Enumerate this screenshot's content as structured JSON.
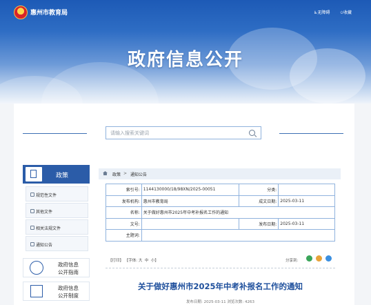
{
  "header": {
    "site_name": "惠州市教育局",
    "accessibility": "无障碍",
    "bookmark": "收藏",
    "banner_title": "政府信息公开"
  },
  "search": {
    "placeholder": "请输入搜索关键词"
  },
  "sidebar": {
    "heading": "政策",
    "items": [
      {
        "label": "规范性文件"
      },
      {
        "label": "其他文件"
      },
      {
        "label": "相关法规文件"
      },
      {
        "label": "通知公告"
      }
    ],
    "big_items": [
      {
        "line1": "政府信息",
        "line2": "公开指南"
      },
      {
        "line1": "政府信息",
        "line2": "公开制度"
      }
    ]
  },
  "breadcrumb": {
    "home": "政策",
    "separator": ">",
    "current": "通知公告"
  },
  "meta": {
    "index_label": "索引号:",
    "index_value": "1144130000/18/98XN/2025-00051",
    "category_label": "分类:",
    "category_value": "",
    "publisher_label": "发布机构:",
    "publisher_value": "惠州市教育局",
    "created_label": "成文日期:",
    "created_value": "2025-03-11",
    "name_label": "名称:",
    "name_value": "关于做好惠州市2025年中考补报名工作的通知",
    "docno_label": "文号:",
    "docno_value": "",
    "published_label": "发布日期:",
    "published_value": "2025-03-11",
    "topic_label": "主题词:",
    "topic_value": ""
  },
  "toolbar": {
    "print": "【打印】",
    "font_label": "【字体:",
    "font_large": "大",
    "font_medium": "中",
    "font_small": "小】",
    "share": "分享到:"
  },
  "document": {
    "title": "关于做好惠州市2025年中考补报名工作的通知",
    "meta_line": "发布日期: 2025-03-11   浏览次数: 4263"
  },
  "colors": {
    "primary": "#2b5ca8",
    "title": "#1e4f9c"
  }
}
